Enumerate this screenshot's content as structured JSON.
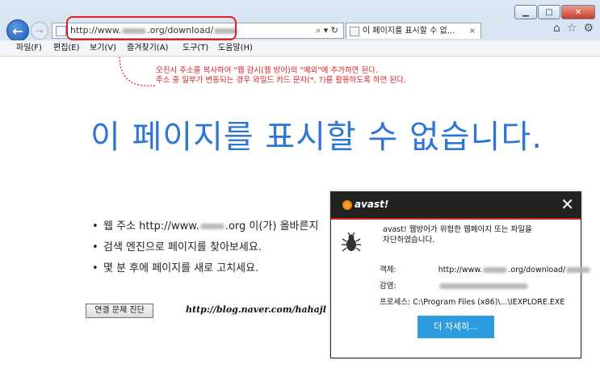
{
  "window": {
    "minimize_icon": "minimize-icon",
    "maximize_icon": "maximize-icon",
    "close_icon": "close-icon"
  },
  "address": {
    "url_prefix": "http://www.",
    "url_mid": ".org/download/",
    "tools": "⌕ ▾ ↻"
  },
  "tab": {
    "title": "이 페이지를 표시할 수 없...",
    "close": "×"
  },
  "right_tools": [
    "⌂",
    "☆",
    "⚙"
  ],
  "menu": [
    "파일(F)",
    "편집(E)",
    "보기(V)",
    "즐겨찾기(A)",
    "도구(T)",
    "도움말(H)"
  ],
  "annotation": {
    "line1": "오진시 주소를 복사하여 \"웹 감시(웹 방어)의 \"예외\"에 추가하면 된다.",
    "line2": "주소 중 일부가 변동되는 경우 와일드 카드 문자(*, ?)를 활용하도록 하면 된다."
  },
  "page": {
    "headline": "이 페이지를 표시할 수 없습니다.",
    "bullet1_prefix": "웹 주소 http://www.",
    "bullet1_suffix": ".org 이(가) 올바른지",
    "bullet2": "검색 엔진으로 페이지를 찾아보세요.",
    "bullet3": "몇 분 후에 페이지를 새로 고치세요.",
    "diag_button": "연결 문제 진단",
    "blog": "http://blog.naver.com/hahajl"
  },
  "popup": {
    "brand": "avast!",
    "close": "✕",
    "message_line1": "avast! 웹방어가 위험한 웹페이지 또는 파일을",
    "message_line2": "차단하였습니다.",
    "object_label": "객체:",
    "object_value_prefix": "http://www.",
    "object_value_suffix": ".org/download/",
    "infection_label": "감염:",
    "process_label": "프로세스:",
    "process_value": "C:\\Program Files (x86)\\...\\IEXPLORE.EXE",
    "more_button": "더 자세히..."
  },
  "colors": {
    "headline": "#2e76d6",
    "annotation": "#e02020",
    "avast_header": "#222222",
    "more_button": "#2d9be0"
  }
}
